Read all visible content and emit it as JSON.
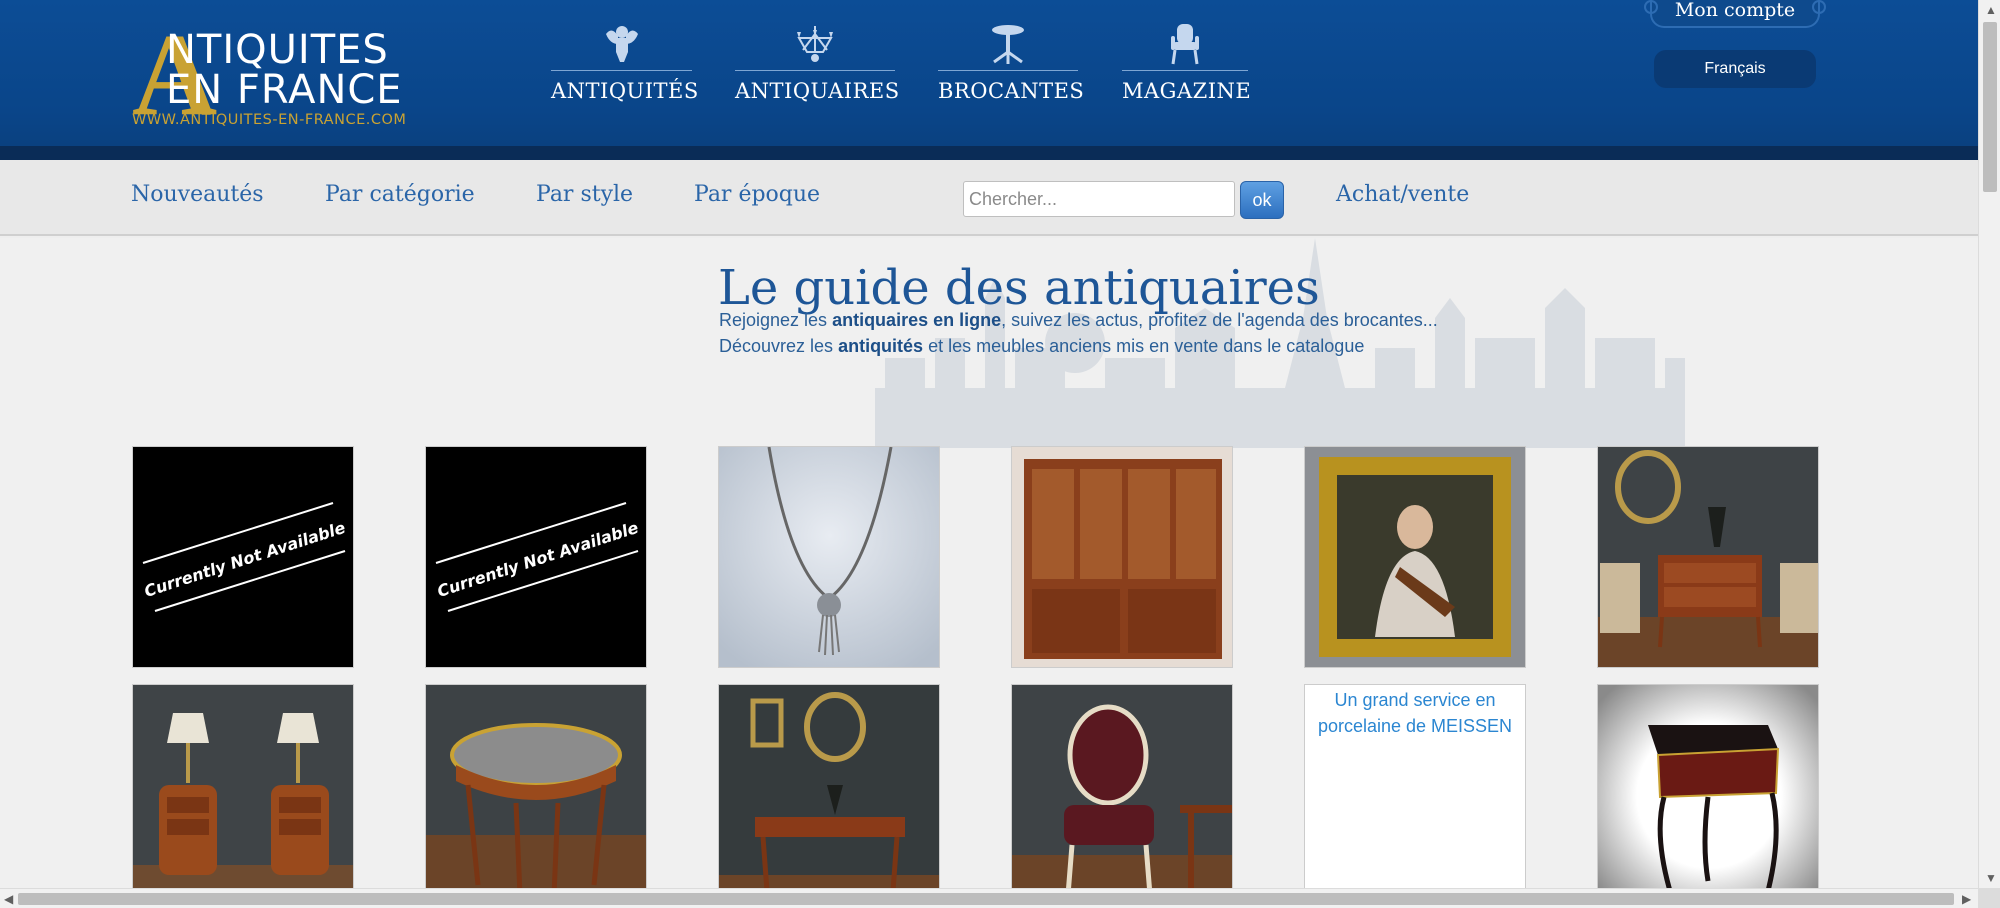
{
  "logo": {
    "line1": "NTIQUITES",
    "line2": "EN FRANCE",
    "letter": "A",
    "url": "WWW.ANTIQUITES-EN-FRANCE.COM"
  },
  "topnav": {
    "items": [
      {
        "label": "ANTIQUITÉS",
        "icon": "cherub-icon"
      },
      {
        "label": "ANTIQUAIRES",
        "icon": "chandelier-icon"
      },
      {
        "label": "BROCANTES",
        "icon": "side-table-icon"
      },
      {
        "label": "MAGAZINE",
        "icon": "armchair-icon"
      }
    ]
  },
  "account": {
    "label": "Mon compte",
    "language": "Français"
  },
  "subnav": {
    "links": [
      "Nouveautés",
      "Par catégorie",
      "Par style",
      "Par époque"
    ],
    "search_placeholder": "Chercher...",
    "search_button": "ok",
    "buy_sell": "Achat/vente"
  },
  "main": {
    "title": "Le guide des antiquaires",
    "intro1": {
      "pre": "Rejoignez les ",
      "bold": "antiquaires en ligne",
      "post": ", suivez les actus, profitez de l'agenda des brocantes..."
    },
    "intro2": {
      "pre": "Découvrez les ",
      "bold": "antiquités",
      "post": " et les meubles anciens mis en vente dans le catalogue"
    }
  },
  "products": {
    "unavailable_text": "Currently Not Available",
    "broken_image_alt": "Un grand service en porcelaine de MEISSEN"
  },
  "colors": {
    "header_blue": "#0c4d96",
    "gold": "#c9a233",
    "link_blue": "#2a65a8"
  }
}
